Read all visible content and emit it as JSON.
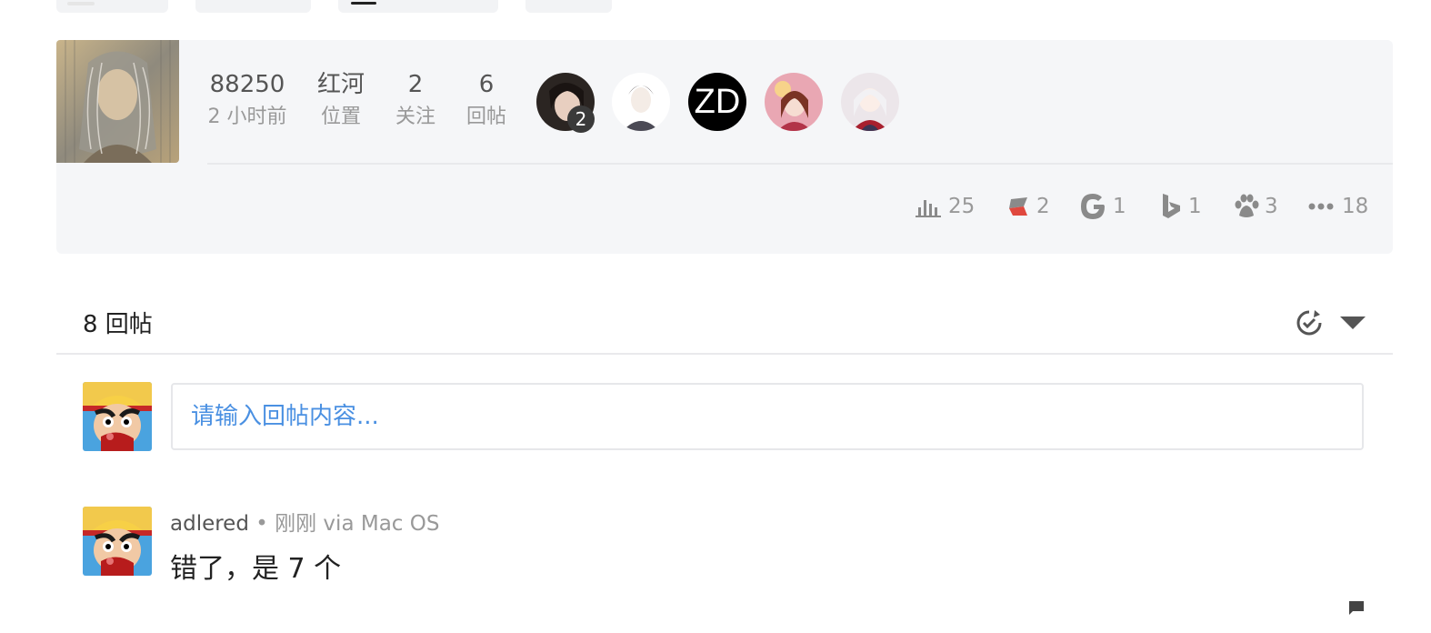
{
  "stats": [
    {
      "value": "88250",
      "label": "2 小时前"
    },
    {
      "value": "红河",
      "label": "位置"
    },
    {
      "value": "2",
      "label": "关注"
    },
    {
      "value": "6",
      "label": "回帖"
    }
  ],
  "viewers": {
    "first_badge": "2",
    "initials": "ZD"
  },
  "sources": [
    {
      "icon": "bar-chart-icon",
      "count": "25"
    },
    {
      "icon": "red-flag-icon",
      "count": "2"
    },
    {
      "icon": "google-icon",
      "count": "1"
    },
    {
      "icon": "bing-icon",
      "count": "1"
    },
    {
      "icon": "baidu-paw-icon",
      "count": "3"
    },
    {
      "icon": "more-icon",
      "count": "18"
    }
  ],
  "replies_header": {
    "count_text": "8 回帖"
  },
  "reply_input": {
    "placeholder": "请输入回帖内容..."
  },
  "reply": {
    "username": "adlered",
    "meta": " • 刚刚 via Mac OS",
    "content": "错了，是 7 个"
  },
  "colors": {
    "panel_bg": "#f5f6f8",
    "placeholder_blue": "#4a90e2",
    "muted_text": "#999999"
  }
}
